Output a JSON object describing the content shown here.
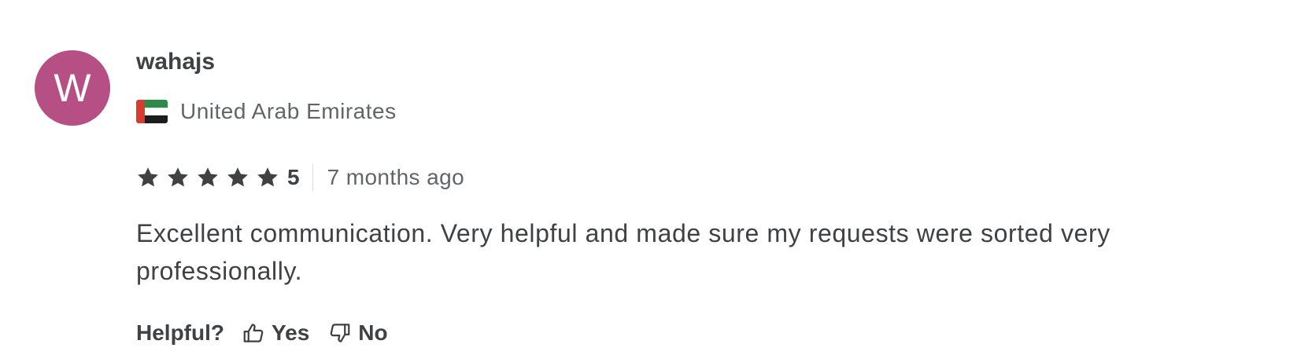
{
  "review": {
    "avatar_letter": "W",
    "avatar_color": "#b54f84",
    "username": "wahajs",
    "country": "United Arab Emirates",
    "flag_icon": "uae-flag-icon",
    "rating": 5,
    "rating_label": "5",
    "time_ago": "7 months ago",
    "text": "Excellent communication. Very helpful and made sure my requests were sorted very professionally.",
    "helpful": {
      "label": "Helpful?",
      "yes_label": "Yes",
      "no_label": "No",
      "yes_icon": "thumbs-up-icon",
      "no_icon": "thumbs-down-icon"
    }
  }
}
